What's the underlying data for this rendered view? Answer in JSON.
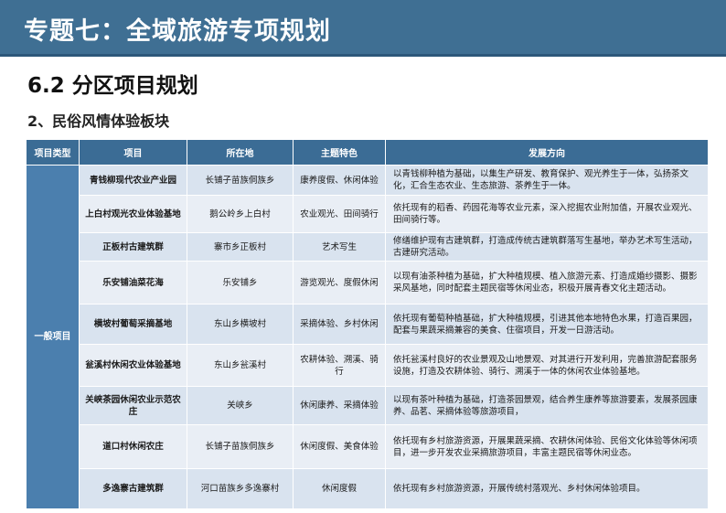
{
  "header": {
    "title": "专题七：全域旅游专项规划"
  },
  "section": {
    "title": "6.2 分区项目规划"
  },
  "subsection": {
    "title": "2、民俗风情体验板块"
  },
  "table": {
    "columns": [
      "项目类型",
      "项目",
      "所在地",
      "主题特色",
      "发展方向"
    ],
    "type_label": "一般项目",
    "rows": [
      {
        "name": "青钱柳现代农业产业园",
        "location": "长铺子苗族侗族乡",
        "theme": "康养度假、休闲体验",
        "direction": "以青钱柳种植为基础，以集生产研发、教育保护、观光养生于一体，弘扬茶文化，汇合生态农业、生态旅游、茶养生于一体。"
      },
      {
        "name": "上白村观光农业体验基地",
        "location": "鹅公岭乡上白村",
        "theme": "农业观光、田间骑行",
        "direction": "依托现有的稻香、药园花海等农业元素，深入挖掘农业附加值，开展农业观光、田间骑行等。"
      },
      {
        "name": "正板村古建筑群",
        "location": "寨市乡正板村",
        "theme": "艺术写生",
        "direction": "修缮维护现有古建筑群，打造成传统古建筑群落写生基地，举办艺术写生活动，古建研究活动。"
      },
      {
        "name": "乐安铺油菜花海",
        "location": "乐安铺乡",
        "theme": "游览观光、度假休闲",
        "direction": "以现有油茶种植为基础，扩大种植规模、植入旅游元素、打造成婚纱摄影、摄影采风基地，同时配套主题民宿等休闲业态，积极开展青春文化主题活动。"
      },
      {
        "name": "横坡村葡萄采摘基地",
        "location": "东山乡横坡村",
        "theme": "采摘体验、乡村休闲",
        "direction": "依托现有葡萄种植基础，扩大种植规模，引进其他本地特色水果，打造百果园，配套与果蔬采摘兼容的美食、住宿项目，开发一日游活动。"
      },
      {
        "name": "瓮溪村休闲农业体验基地",
        "location": "东山乡瓮溪村",
        "theme": "农耕体验、溯溪、骑行",
        "direction": "依托瓮溪村良好的农业景观及山地景观、对其进行开发利用，完善旅游配套服务设施，打造及农耕体验、骑行、溯溪于一体的休闲农业体验基地。"
      },
      {
        "name": "关峡茶园休闲农业示范农庄",
        "location": "关峡乡",
        "theme": "休闲康养、采摘体验",
        "direction": "以现有茶叶种植为基础，打造茶园景观，结合养生康养等旅游要素，发展茶园康养、品茗、采摘体验等旅游项目，"
      },
      {
        "name": "道口村休闲农庄",
        "location": "长铺子苗族侗族乡",
        "theme": "休闲度假、美食体验",
        "direction": "依托现有乡村旅游资源，开展果蔬采摘、农耕休闲体验、民俗文化体验等休闲项目，进一步开发农业采摘旅游项目，丰富主题民宿等休闲业态。"
      },
      {
        "name": "多逸寨古建筑群",
        "location": "河口苗族乡多逸寨村",
        "theme": "休闲度假",
        "direction": "依托现有乡村旅游资源，开展传统村落观光、乡村休闲体验项目。"
      }
    ]
  }
}
